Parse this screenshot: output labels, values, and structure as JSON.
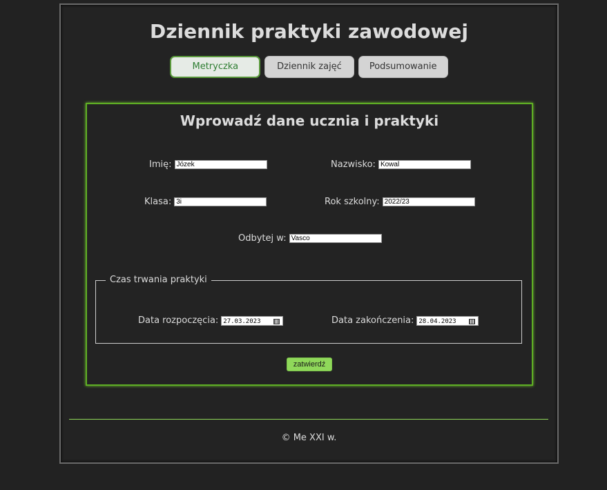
{
  "header": {
    "title": "Dziennik praktyki zawodowej"
  },
  "tabs": [
    {
      "label": "Metryczka",
      "active": true
    },
    {
      "label": "Dziennik zajęć",
      "active": false
    },
    {
      "label": "Podsumowanie",
      "active": false
    }
  ],
  "form": {
    "title": "Wprowadź dane ucznia i praktyki",
    "first_name": {
      "label": "Imię:",
      "value": "Józek"
    },
    "last_name": {
      "label": "Nazwisko:",
      "value": "Kowal"
    },
    "class": {
      "label": "Klasa:",
      "value": "3i"
    },
    "school_year": {
      "label": "Rok szkolny:",
      "value": "2022/23"
    },
    "held_at": {
      "label": "Odbytej w:",
      "value": "Vasco"
    },
    "duration": {
      "legend": "Czas trwania praktyki",
      "start": {
        "label": "Data rozpoczęcia:",
        "value": "27.03.2023",
        "icon": "calendar-icon"
      },
      "end": {
        "label": "Data zakończenia:",
        "value": "28.04.2023",
        "icon": "calendar-icon"
      }
    },
    "submit_label": "zatwierdź"
  },
  "footer": {
    "text": "© Me XXI w."
  },
  "colors": {
    "accent": "#8fd85a",
    "border_accent": "#5fae24",
    "background": "#222222"
  }
}
